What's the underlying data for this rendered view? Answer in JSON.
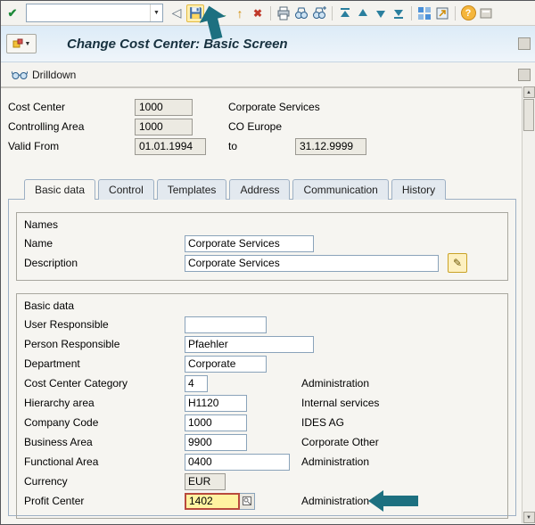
{
  "colors": {
    "teal_arrow": "#1d7080",
    "field_highlight_bg": "#fff3a1",
    "field_highlight_border": "#b94a3d",
    "titlebar_top": "#dcebf7",
    "titlebar_bottom": "#eff5fa",
    "tab_border": "#9db0c4"
  },
  "icons": {
    "enter": "✔",
    "dropdown": "▼",
    "back_outline": "◁",
    "nav_back": "←",
    "nav_exit": "↑",
    "nav_cancel": "✖",
    "help": "?",
    "edit_pencil": "✎",
    "scroll_up": "▲",
    "scroll_down": "▼",
    "menu_dropdown": "▼"
  },
  "toolbar": {
    "command_value": ""
  },
  "titlebar": {
    "title": "Change Cost Center: Basic Screen"
  },
  "appbar": {
    "drilldown_label": "Drilldown"
  },
  "header": {
    "rows": [
      {
        "label": "Cost Center",
        "value": "1000",
        "desc": "Corporate Services"
      },
      {
        "label": "Controlling Area",
        "value": "1000",
        "desc": "CO Europe"
      },
      {
        "label": "Valid From",
        "value": "01.01.1994",
        "to_label": "to",
        "to_value": "31.12.9999"
      }
    ]
  },
  "tabs": {
    "items": [
      {
        "label": "Basic data",
        "active": true
      },
      {
        "label": "Control",
        "active": false
      },
      {
        "label": "Templates",
        "active": false
      },
      {
        "label": "Address",
        "active": false
      },
      {
        "label": "Communication",
        "active": false
      },
      {
        "label": "History",
        "active": false
      }
    ]
  },
  "groups": {
    "names": {
      "title": "Names",
      "rows": [
        {
          "label": "Name",
          "value": "Corporate Services"
        },
        {
          "label": "Description",
          "value": "Corporate Services"
        }
      ]
    },
    "basic": {
      "title": "Basic data",
      "rows": [
        {
          "label": "User Responsible",
          "value": "",
          "desc": ""
        },
        {
          "label": "Person Responsible",
          "value": "Pfaehler",
          "desc": ""
        },
        {
          "label": "Department",
          "value": "Corporate",
          "desc": ""
        },
        {
          "label": "Cost Center Category",
          "value": "4",
          "desc": "Administration"
        },
        {
          "label": "Hierarchy area",
          "value": "H1120",
          "desc": "Internal services"
        },
        {
          "label": "Company Code",
          "value": "1000",
          "desc": "IDES AG"
        },
        {
          "label": "Business Area",
          "value": "9900",
          "desc": "Corporate Other"
        },
        {
          "label": "Functional Area",
          "value": "0400",
          "desc": "Administration"
        },
        {
          "label": "Currency",
          "value": "EUR",
          "desc": ""
        },
        {
          "label": "Profit Center",
          "value": "1402",
          "desc": "Administration",
          "highlighted": true
        }
      ]
    }
  }
}
